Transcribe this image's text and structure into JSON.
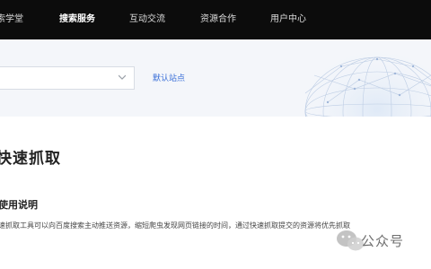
{
  "nav": {
    "items": [
      {
        "label": "索学堂"
      },
      {
        "label": "搜索服务"
      },
      {
        "label": "互动交流"
      },
      {
        "label": "资源合作"
      },
      {
        "label": "用户中心"
      }
    ]
  },
  "site_selector": {
    "value": "",
    "default_link": "默认站点"
  },
  "main": {
    "title": "快速抓取",
    "section_title": "使用说明",
    "description": "速抓取工具可以向百度搜索主动推送资源，缩短爬虫发现网页链接的时间，通过快速抓取提交的资源将优先抓取"
  },
  "watermark": {
    "text": "公众号"
  },
  "colors": {
    "nav_bg": "#0c0c0c",
    "link": "#3a6fd8",
    "banner_bg": "#f4f6fa"
  }
}
